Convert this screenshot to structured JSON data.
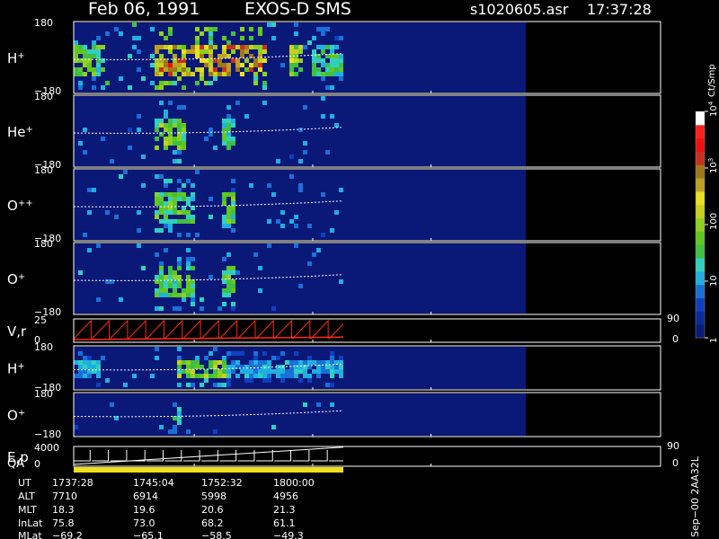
{
  "header": {
    "date": "Feb 06, 1991",
    "instrument": "EXOS-D SMS",
    "file": "s1020605.asr",
    "time": "17:37:28"
  },
  "colorbar": {
    "unit": "Ct/Smp",
    "tick_labels": [
      "1",
      "10",
      "100",
      "10",
      "10"
    ],
    "tick_exponents": [
      "",
      "",
      "",
      "3",
      "4"
    ],
    "tick_values": [
      1,
      10,
      100,
      1000,
      10000
    ],
    "colors": [
      "#0a1a78",
      "#0b2a9a",
      "#1040c0",
      "#1a70d8",
      "#20b0e0",
      "#30d0c0",
      "#40c040",
      "#60c820",
      "#90d020",
      "#c8d020",
      "#e8e020",
      "#c0a020",
      "#a07818",
      "#c83020",
      "#f01010",
      "#ff2020",
      "#ffffff"
    ]
  },
  "panels": [
    {
      "label_base": "H",
      "label_sup": "+",
      "ymax": "180",
      "ymin": "−180",
      "kind": "spectrogram"
    },
    {
      "label_base": "He",
      "label_sup": "+",
      "ymax": "180",
      "ymin": "−180",
      "kind": "spectrogram"
    },
    {
      "label_base": "O",
      "label_sup": "++",
      "ymax": "180",
      "ymin": "−180",
      "kind": "spectrogram"
    },
    {
      "label_base": "O",
      "label_sup": "+",
      "ymax": "180",
      "ymin": "−180",
      "kind": "spectrogram"
    },
    {
      "label_base": "V,r",
      "label_sup": "",
      "ymax": "25",
      "ymin": "0",
      "right_max": "90",
      "right_min": "0",
      "kind": "line"
    },
    {
      "label_base": "H",
      "label_sup": "+",
      "ymax": "180",
      "ymin": "−180",
      "kind": "spectrogram"
    },
    {
      "label_base": "O",
      "label_sup": "+",
      "ymax": "180",
      "ymin": "−180",
      "kind": "spectrogram"
    },
    {
      "label_base": "E,p",
      "label_sup": "",
      "label2": "QA",
      "ymax": "4000",
      "ymin": "0",
      "right_max": "90",
      "right_min": "0",
      "kind": "line"
    }
  ],
  "ephemeris": {
    "row_labels": [
      "UT",
      "ALT",
      "MLT",
      "InLat",
      "MLat"
    ],
    "columns": [
      [
        "1737:28",
        "7710",
        "18.3",
        "75.8",
        "−69.2"
      ],
      [
        "1745:04",
        "6914",
        "19.6",
        "73.0",
        "−65.1"
      ],
      [
        "1752:32",
        "5998",
        "20.6",
        "68.2",
        "−58.5"
      ],
      [
        "1800:00",
        "4956",
        "21.3",
        "61.1",
        "−49.3"
      ]
    ]
  },
  "footer_stamp": "Sep−00 2AA32L",
  "chart_data": {
    "type": "heatmap",
    "title": "Feb 06, 1991   EXOS-D SMS",
    "x": [
      "1737:28",
      "1745:04",
      "1752:32",
      "1800:00"
    ],
    "x_values_min": [
      0,
      7.6,
      15.07,
      22.53
    ],
    "x_range_min": [
      0,
      37
    ],
    "data_end_min": 28.5,
    "spin_period_min": 1.15,
    "colorbar_range": [
      1,
      10000
    ],
    "colorbar_scale": "log",
    "series": [
      {
        "name": "H+",
        "ylim": [
          -180,
          180
        ],
        "events": [
          {
            "t": [
              0,
              1.9
            ],
            "level": 0.5
          },
          {
            "t": [
              5,
              12
            ],
            "level": 0.85
          },
          {
            "t": [
              13.5,
              14.3
            ],
            "level": 0.6
          },
          {
            "t": [
              14.8,
              17
            ],
            "level": 0.45
          },
          {
            "t": [
              17.5,
              28.5
            ],
            "level": 1.0
          }
        ]
      },
      {
        "name": "He+",
        "ylim": [
          -180,
          180
        ],
        "events": [
          {
            "t": [
              5,
              7
            ],
            "level": 0.55
          },
          {
            "t": [
              9.3,
              10
            ],
            "level": 0.45
          },
          {
            "t": [
              17.5,
              28.5
            ],
            "level": 0.9
          }
        ]
      },
      {
        "name": "O++",
        "ylim": [
          -180,
          180
        ],
        "events": [
          {
            "t": [
              5,
              7.5
            ],
            "level": 0.5
          },
          {
            "t": [
              9.3,
              10
            ],
            "level": 0.5
          },
          {
            "t": [
              17.5,
              28.5
            ],
            "level": 0.95
          }
        ]
      },
      {
        "name": "O+",
        "ylim": [
          -180,
          180
        ],
        "events": [
          {
            "t": [
              5,
              7.5
            ],
            "level": 0.5
          },
          {
            "t": [
              9.3,
              10
            ],
            "level": 0.5
          },
          {
            "t": [
              17.5,
              28.5
            ],
            "level": 0.95
          }
        ]
      },
      {
        "name": "V,r",
        "ylim": [
          0,
          25
        ],
        "kind": "line"
      },
      {
        "name": "H+",
        "ylim": [
          -180,
          180
        ],
        "events": [
          {
            "t": [
              0,
              1.5
            ],
            "level": 0.35
          },
          {
            "t": [
              6.5,
              9.5
            ],
            "level": 0.6
          },
          {
            "t": [
              9.5,
              28.5
            ],
            "level": 0.3
          }
        ]
      },
      {
        "name": "O+",
        "ylim": [
          -180,
          180
        ],
        "events": [
          {
            "t": [
              6,
              6.7
            ],
            "level": 0.4
          },
          {
            "t": [
              21,
              24
            ],
            "level": 0.45
          }
        ]
      },
      {
        "name": "E,p",
        "ylim": [
          0,
          4000
        ],
        "kind": "line"
      }
    ]
  }
}
